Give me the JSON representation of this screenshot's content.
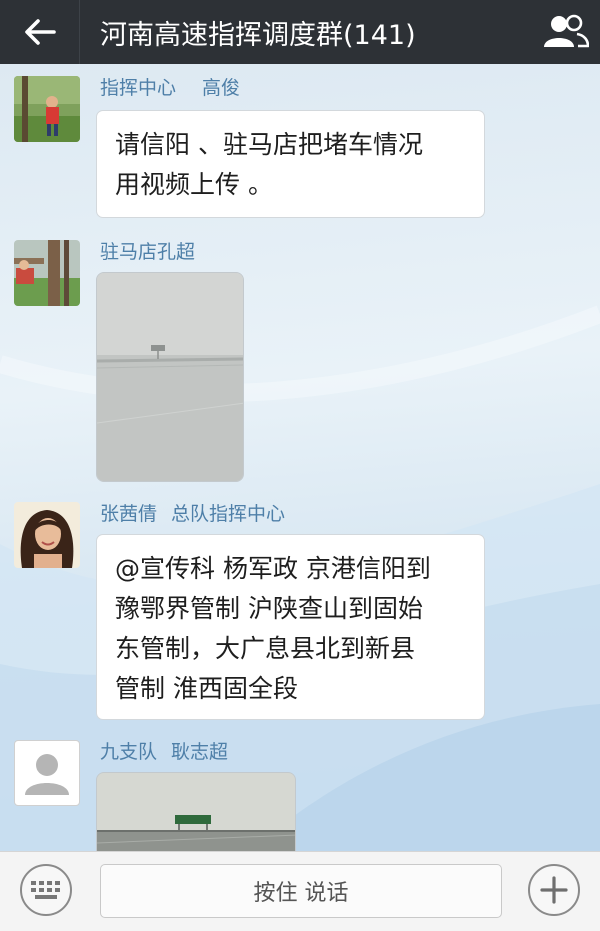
{
  "header": {
    "title": "河南高速指挥调度群(141)",
    "back_icon": "arrow-left-icon",
    "members_icon": "group-members-icon"
  },
  "messages": [
    {
      "sender_parts": [
        "指挥中心",
        "高俊"
      ],
      "type": "text",
      "lines": [
        "请信阳 、驻马店把堵车情况",
        "用视频上传 。"
      ]
    },
    {
      "sender_parts": [
        "驻马店孔超"
      ],
      "type": "image",
      "image": "snowy-highway-photo"
    },
    {
      "sender_parts": [
        "张茜倩",
        "总队指挥中心"
      ],
      "type": "text",
      "lines": [
        "@宣传科  杨军政 京港信阳到",
        "豫鄂界管制 沪陕查山到固始",
        "东管制，大广息县北到新县",
        "管制 淮西固全段"
      ]
    },
    {
      "sender_parts": [
        "九支队",
        "耿志超"
      ],
      "type": "image",
      "image": "foggy-expressway-photo"
    }
  ],
  "input_bar": {
    "keyboard_icon": "keyboard-icon",
    "hold_to_talk": "按住 说话",
    "plus_icon": "plus-icon"
  },
  "colors": {
    "header_bg": "#2d3136",
    "sender_name": "#4e7fa8",
    "bubble_bg": "#ffffff"
  }
}
